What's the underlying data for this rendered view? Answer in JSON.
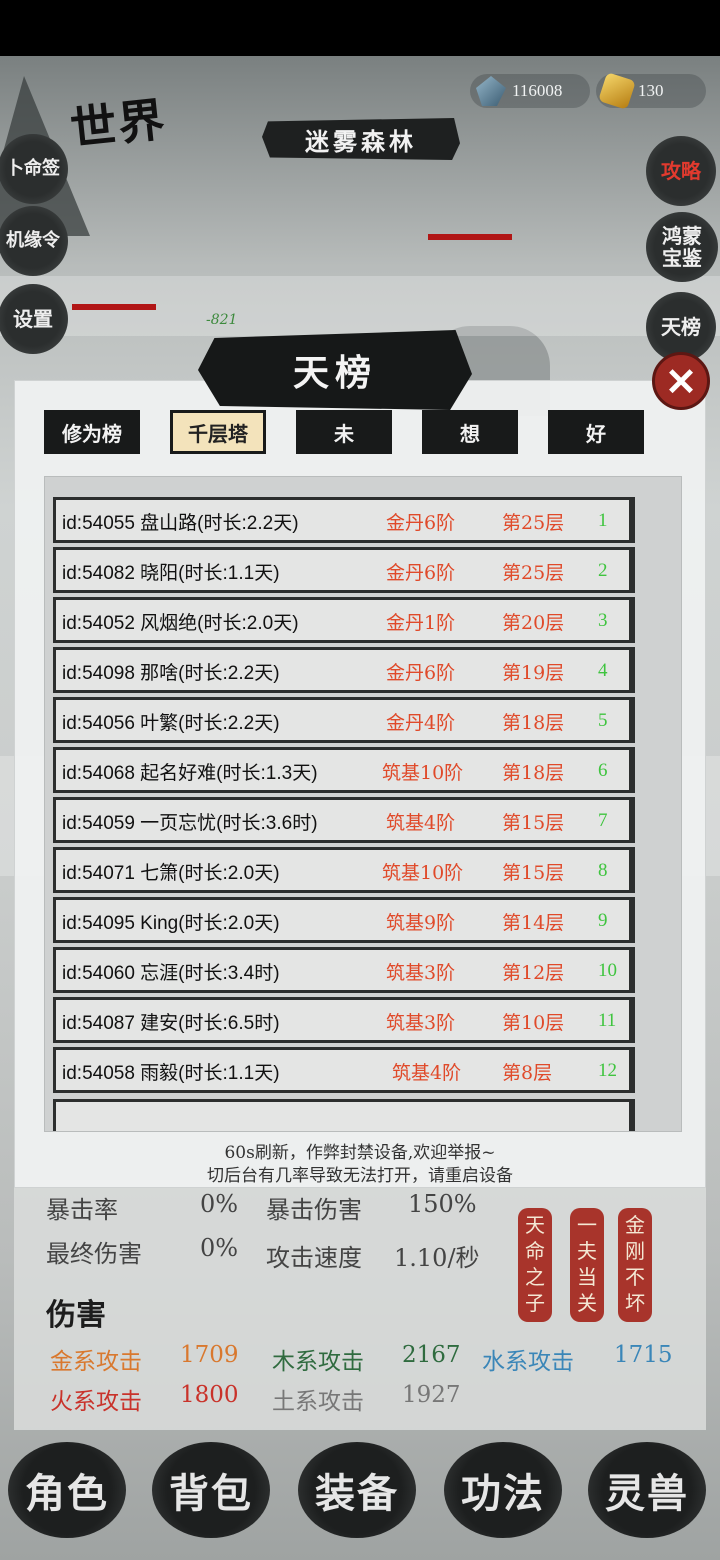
{
  "header": {
    "world_title": "世界",
    "map_name": "迷雾森林",
    "currency_spirit": "116008",
    "currency_gold": "130"
  },
  "left_menu": [
    "卜命签",
    "机缘令",
    "设置"
  ],
  "right_menu": [
    "攻略",
    "鸿蒙宝鉴",
    "天榜"
  ],
  "battle": {
    "damage": "-821"
  },
  "dialog": {
    "title": "天榜",
    "close": "✕",
    "tabs": [
      "修为榜",
      "千层塔",
      "未",
      "想",
      "好"
    ],
    "active_tab": "千层塔",
    "rows": [
      {
        "id": "id:54055 盘山路(时长:2.2天)",
        "level": "金丹6阶",
        "floor": "第25层",
        "rank": "1"
      },
      {
        "id": "id:54082 晓阳(时长:1.1天)",
        "level": "金丹6阶",
        "floor": "第25层",
        "rank": "2"
      },
      {
        "id": "id:54052 风烟绝(时长:2.0天)",
        "level": "金丹1阶",
        "floor": "第20层",
        "rank": "3"
      },
      {
        "id": "id:54098 那啥(时长:2.2天)",
        "level": "金丹6阶",
        "floor": "第19层",
        "rank": "4"
      },
      {
        "id": "id:54056 叶繁(时长:2.2天)",
        "level": "金丹4阶",
        "floor": "第18层",
        "rank": "5"
      },
      {
        "id": "id:54068 起名好难(时长:1.3天)",
        "level": "筑基10阶",
        "floor": "第18层",
        "rank": "6"
      },
      {
        "id": "id:54059 一页忘忧(时长:3.6时)",
        "level": "筑基4阶",
        "floor": "第15层",
        "rank": "7"
      },
      {
        "id": "id:54071 七箫(时长:2.0天)",
        "level": "筑基10阶",
        "floor": "第15层",
        "rank": "8"
      },
      {
        "id": "id:54095 King(时长:2.0天)",
        "level": "筑基9阶",
        "floor": "第14层",
        "rank": "9"
      },
      {
        "id": "id:54060 忘涯(时长:3.4时)",
        "level": "筑基3阶",
        "floor": "第12层",
        "rank": "10"
      },
      {
        "id": "id:54087 建安(时长:6.5时)",
        "level": "筑基3阶",
        "floor": "第10层",
        "rank": "11"
      },
      {
        "id": "id:54058 雨毅(时长:1.1天)",
        "level": "筑基4阶",
        "floor": "第8层",
        "rank": "12"
      }
    ],
    "footer_line1": "60s刷新，作弊封禁设备,欢迎举报~",
    "footer_line2": "切后台有几率导致无法打开，请重启设备"
  },
  "stats": {
    "crit_rate_label": "暴击率",
    "crit_rate": "0%",
    "crit_dmg_label": "暴击伤害",
    "crit_dmg": "150%",
    "final_dmg_label": "最终伤害",
    "final_dmg": "0%",
    "atk_speed_label": "攻击速度",
    "atk_speed": "1.10/秒",
    "damage_heading": "伤害",
    "metal_label": "金系攻击",
    "metal": "1709",
    "wood_label": "木系攻击",
    "wood": "2167",
    "water_label": "水系攻击",
    "water": "1715",
    "fire_label": "火系攻击",
    "fire": "1800",
    "earth_label": "土系攻击",
    "earth": "1927"
  },
  "talents": [
    "天命之子",
    "一夫当关",
    "金刚不坏"
  ],
  "bottom_nav": [
    "角色",
    "背包",
    "装备",
    "功法",
    "灵兽"
  ],
  "colors": {
    "level_red": "#e04a2a",
    "rank_green": "#3fc43f",
    "metal": "#d9782e",
    "wood": "#2f6b3f",
    "water": "#3a86b8",
    "fire": "#c9322a",
    "earth": "#777777"
  }
}
